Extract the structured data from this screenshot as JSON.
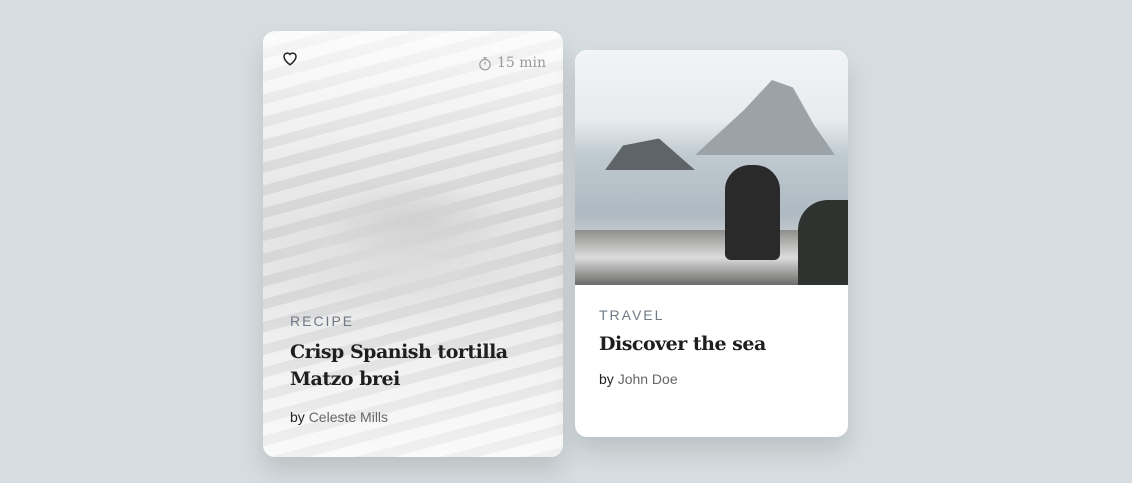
{
  "cards": [
    {
      "category": "RECIPE",
      "title_line1": "Crisp Spanish tortilla",
      "title_line2": "Matzo brei",
      "by": "by",
      "author": "Celeste Mills",
      "time": "15 min",
      "icons": [
        "heart-icon",
        "stopwatch-icon"
      ]
    },
    {
      "category": "TRAVEL",
      "title": "Discover the sea",
      "by": "by",
      "author": "John Doe"
    }
  ],
  "colors": {
    "background": "#d5dde0",
    "category": "#6f7a86"
  }
}
